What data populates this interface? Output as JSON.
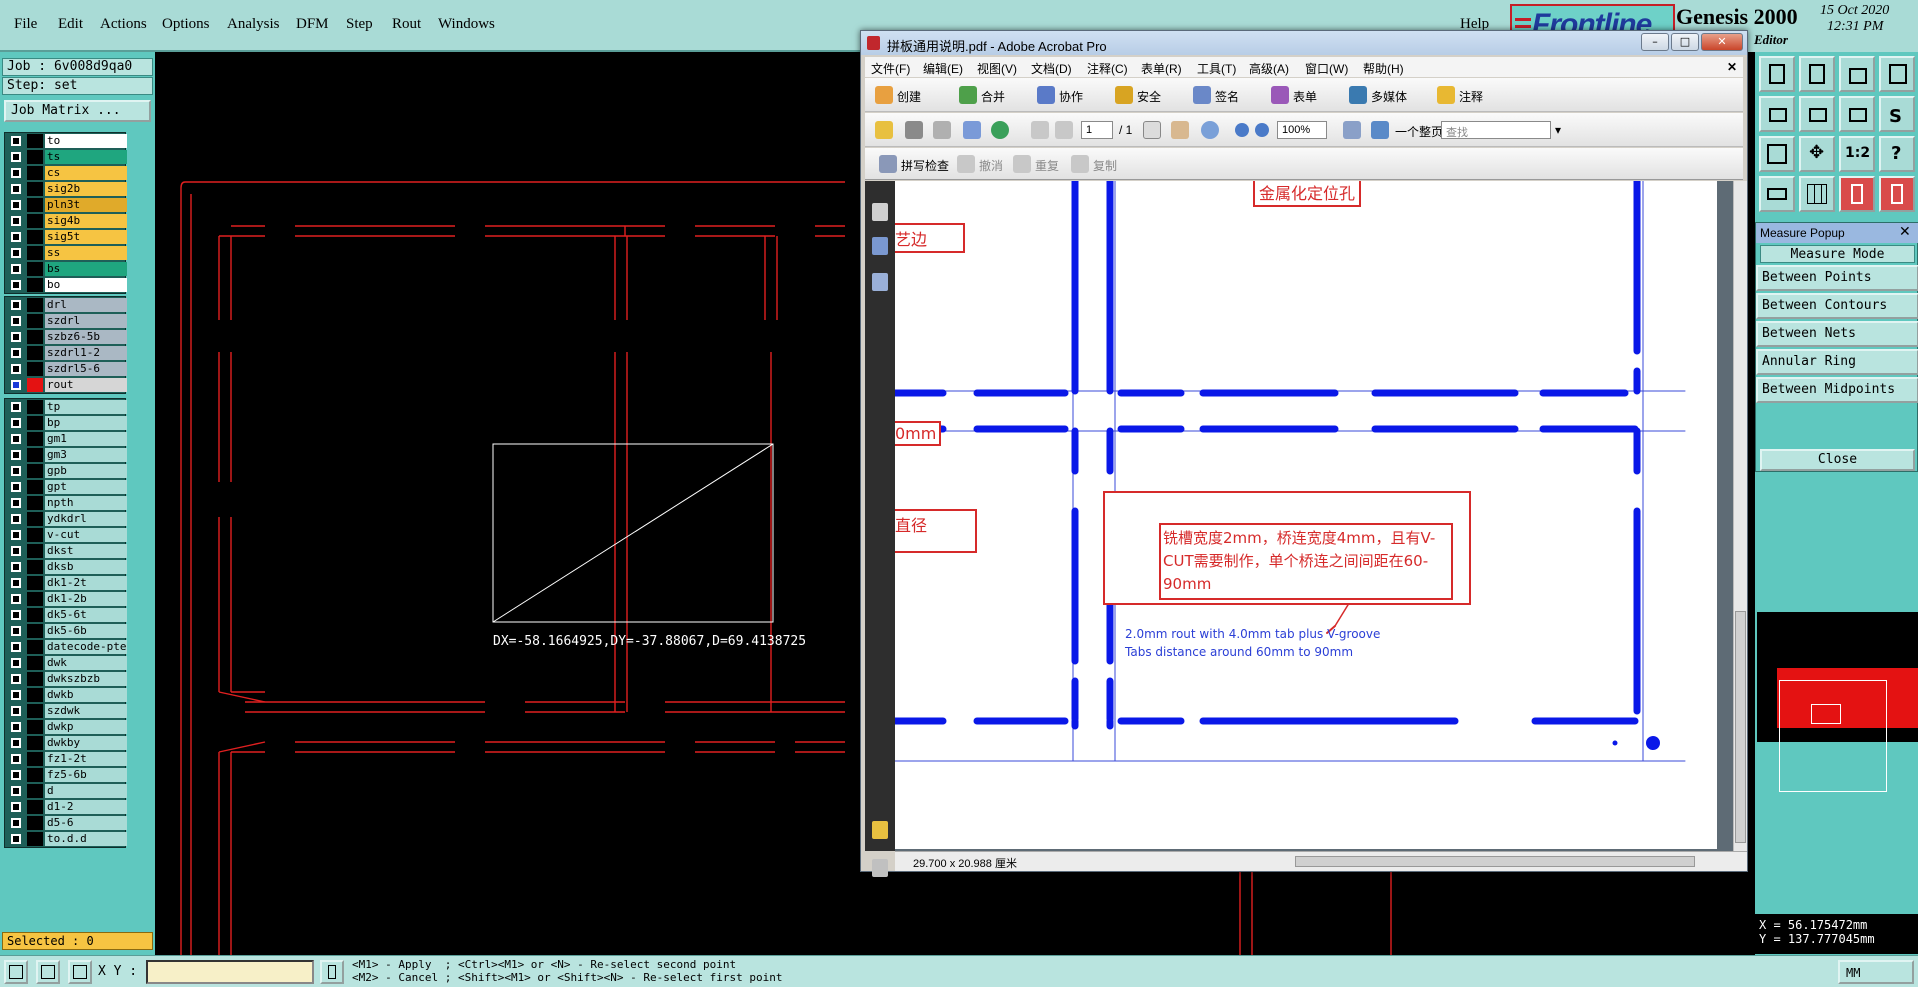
{
  "menubar": {
    "items": [
      {
        "label": "File"
      },
      {
        "label": "Edit"
      },
      {
        "label": "Actions"
      },
      {
        "label": "Options"
      },
      {
        "label": "Analysis"
      },
      {
        "label": "DFM"
      },
      {
        "label": "Step"
      },
      {
        "label": "Rout"
      },
      {
        "label": "Windows"
      }
    ],
    "help": "Help"
  },
  "brand": {
    "logo": "Frontline",
    "title": "Genesis 2000",
    "date": "15 Oct 2020",
    "time": "12:31 PM",
    "subtitle": "Editor"
  },
  "job": {
    "job_label": "Job : 6v008d9qa0",
    "step_label": "Step: set",
    "matrix_button": "Job Matrix ..."
  },
  "layers": {
    "group1": [
      {
        "name": "to",
        "color": "#ffffff"
      },
      {
        "name": "ts",
        "color": "#1fa67f"
      },
      {
        "name": "cs",
        "color": "#f6c442"
      },
      {
        "name": "sig2b",
        "color": "#f6c442"
      },
      {
        "name": "pln3t",
        "color": "#e0aa2a"
      },
      {
        "name": "sig4b",
        "color": "#f6c442"
      },
      {
        "name": "sig5t",
        "color": "#f6c442"
      },
      {
        "name": "ss",
        "color": "#f6c442"
      },
      {
        "name": "bs",
        "color": "#1fa67f"
      },
      {
        "name": "bo",
        "color": "#ffffff"
      }
    ],
    "group2": [
      {
        "name": "drl",
        "color": "#aab8c4"
      },
      {
        "name": "szdrl",
        "color": "#aab8c4"
      },
      {
        "name": "szbz6-5b",
        "color": "#aab8c4"
      },
      {
        "name": "szdrl1-2",
        "color": "#aab8c4"
      },
      {
        "name": "szdrl5-6",
        "color": "#aab8c4"
      },
      {
        "name": "rout",
        "color": "#d6d6d6",
        "active": true
      }
    ],
    "group3": [
      {
        "name": "tp"
      },
      {
        "name": "bp"
      },
      {
        "name": "gm1"
      },
      {
        "name": "gm3"
      },
      {
        "name": "gpb"
      },
      {
        "name": "gpt"
      },
      {
        "name": "npth"
      },
      {
        "name": "ydkdrl"
      },
      {
        "name": "v-cut"
      },
      {
        "name": "dkst"
      },
      {
        "name": "dksb"
      },
      {
        "name": "dk1-2t"
      },
      {
        "name": "dk1-2b"
      },
      {
        "name": "dk5-6t"
      },
      {
        "name": "dk5-6b"
      },
      {
        "name": "datecode-pte"
      },
      {
        "name": "dwk"
      },
      {
        "name": "dwkszbzb"
      },
      {
        "name": "dwkb"
      },
      {
        "name": "szdwk"
      },
      {
        "name": "dwkp"
      },
      {
        "name": "dwkby"
      },
      {
        "name": "fz1-2t"
      },
      {
        "name": "fz5-6b"
      },
      {
        "name": "d"
      },
      {
        "name": "d1-2"
      },
      {
        "name": "d5-6"
      },
      {
        "name": "to.d.d"
      }
    ],
    "group3_color": "#a9dbd6",
    "selected": "Selected : 0"
  },
  "canvas": {
    "measure_text": "DX=-58.1664925,DY=-37.88067,D=69.4138725",
    "rout_color": "#e02020"
  },
  "status": {
    "xy_label": "X Y :",
    "xy_value": "",
    "hint_line1": "<M1> - Apply  ; <Ctrl><M1> or <N> - Re-select second point",
    "hint_line2": "<M2> - Cancel ; <Shift><M1> or <Shift><N> - Re-select first point",
    "units": "MM"
  },
  "measure_popup": {
    "title": "Measure Popup",
    "mode_label": "Measure Mode",
    "items": [
      {
        "label": "Between Points"
      },
      {
        "label": "Between Contours"
      },
      {
        "label": "Between Nets"
      },
      {
        "label": "Annular Ring"
      },
      {
        "label": "Between Midpoints"
      }
    ],
    "close": "Close"
  },
  "coords": {
    "x": "X = 56.175472mm",
    "y": "Y = 137.777045mm"
  },
  "acrobat": {
    "title": "拼板通用说明.pdf - Adobe Acrobat Pro",
    "menu": [
      {
        "label": "文件(F)"
      },
      {
        "label": "编辑(E)"
      },
      {
        "label": "视图(V)"
      },
      {
        "label": "文档(D)"
      },
      {
        "label": "注释(C)"
      },
      {
        "label": "表单(R)"
      },
      {
        "label": "工具(T)"
      },
      {
        "label": "高级(A)"
      },
      {
        "label": "窗口(W)"
      },
      {
        "label": "帮助(H)"
      }
    ],
    "toolbar1": [
      {
        "label": "创建"
      },
      {
        "label": "合并"
      },
      {
        "label": "协作"
      },
      {
        "label": "安全"
      },
      {
        "label": "签名"
      },
      {
        "label": "表单"
      },
      {
        "label": "多媒体"
      },
      {
        "label": "注释"
      }
    ],
    "page_current": "1",
    "page_total": "/ 1",
    "zoom": "100%",
    "fit_label": "一个整页",
    "search_placeholder": "查找",
    "toolbar3": {
      "spell": "拼写检查",
      "undo": "撤消",
      "redo": "重复",
      "copy": "复制"
    },
    "page_size": "29.700 x 20.988 厘米",
    "doc": {
      "label_hole": "金属化定位孔",
      "label_edge": "艺边",
      "label_mm": "0mm",
      "label_dia": "直径",
      "note": "铣槽宽度2mm，桥连宽度4mm，且有V-CUT需要制作，单个桥连之间间距在60-90mm",
      "note_en1": "2.0mm rout with 4.0mm tab plus V-groove",
      "note_en2": "Tabs distance around 60mm to 90mm",
      "rout_color": "#0a18e8",
      "label_color": "#d62a2a"
    }
  }
}
